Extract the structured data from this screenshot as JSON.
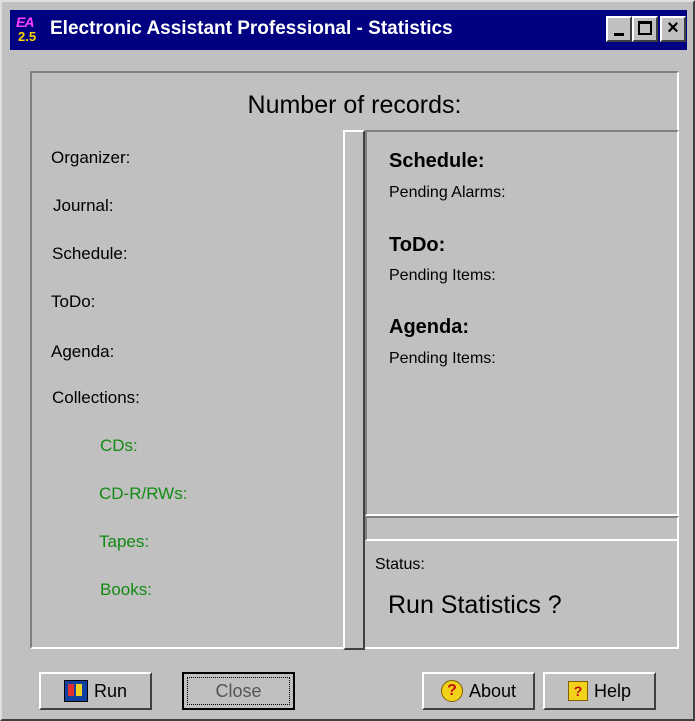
{
  "window": {
    "title": "Electronic Assistant Professional - Statistics",
    "icon_text": "EA",
    "icon_version": "2.5",
    "controls": {
      "minimize": "_",
      "maximize": "□",
      "close": "×"
    }
  },
  "main": {
    "heading": "Number of records:",
    "left_labels": [
      "Organizer:",
      "Journal:",
      "Schedule:",
      "ToDo:",
      "Agenda:",
      "Collections:"
    ],
    "collections": [
      "CDs:",
      "CD-R/RWs:",
      "Tapes:",
      "Books:"
    ],
    "right": {
      "schedule_heading": "Schedule:",
      "schedule_sub": "Pending Alarms:",
      "todo_heading": "ToDo:",
      "todo_sub": "Pending Items:",
      "agenda_heading": "Agenda:",
      "agenda_sub": "Pending Items:"
    },
    "status_label": "Status:",
    "status_text": "Run Statistics ?"
  },
  "buttons": {
    "run": "Run",
    "close": "Close",
    "about": "About",
    "help": "Help"
  },
  "colors": {
    "title_bar": "#000080",
    "collection_text": "#138a13",
    "face": "#c0c0c0"
  }
}
